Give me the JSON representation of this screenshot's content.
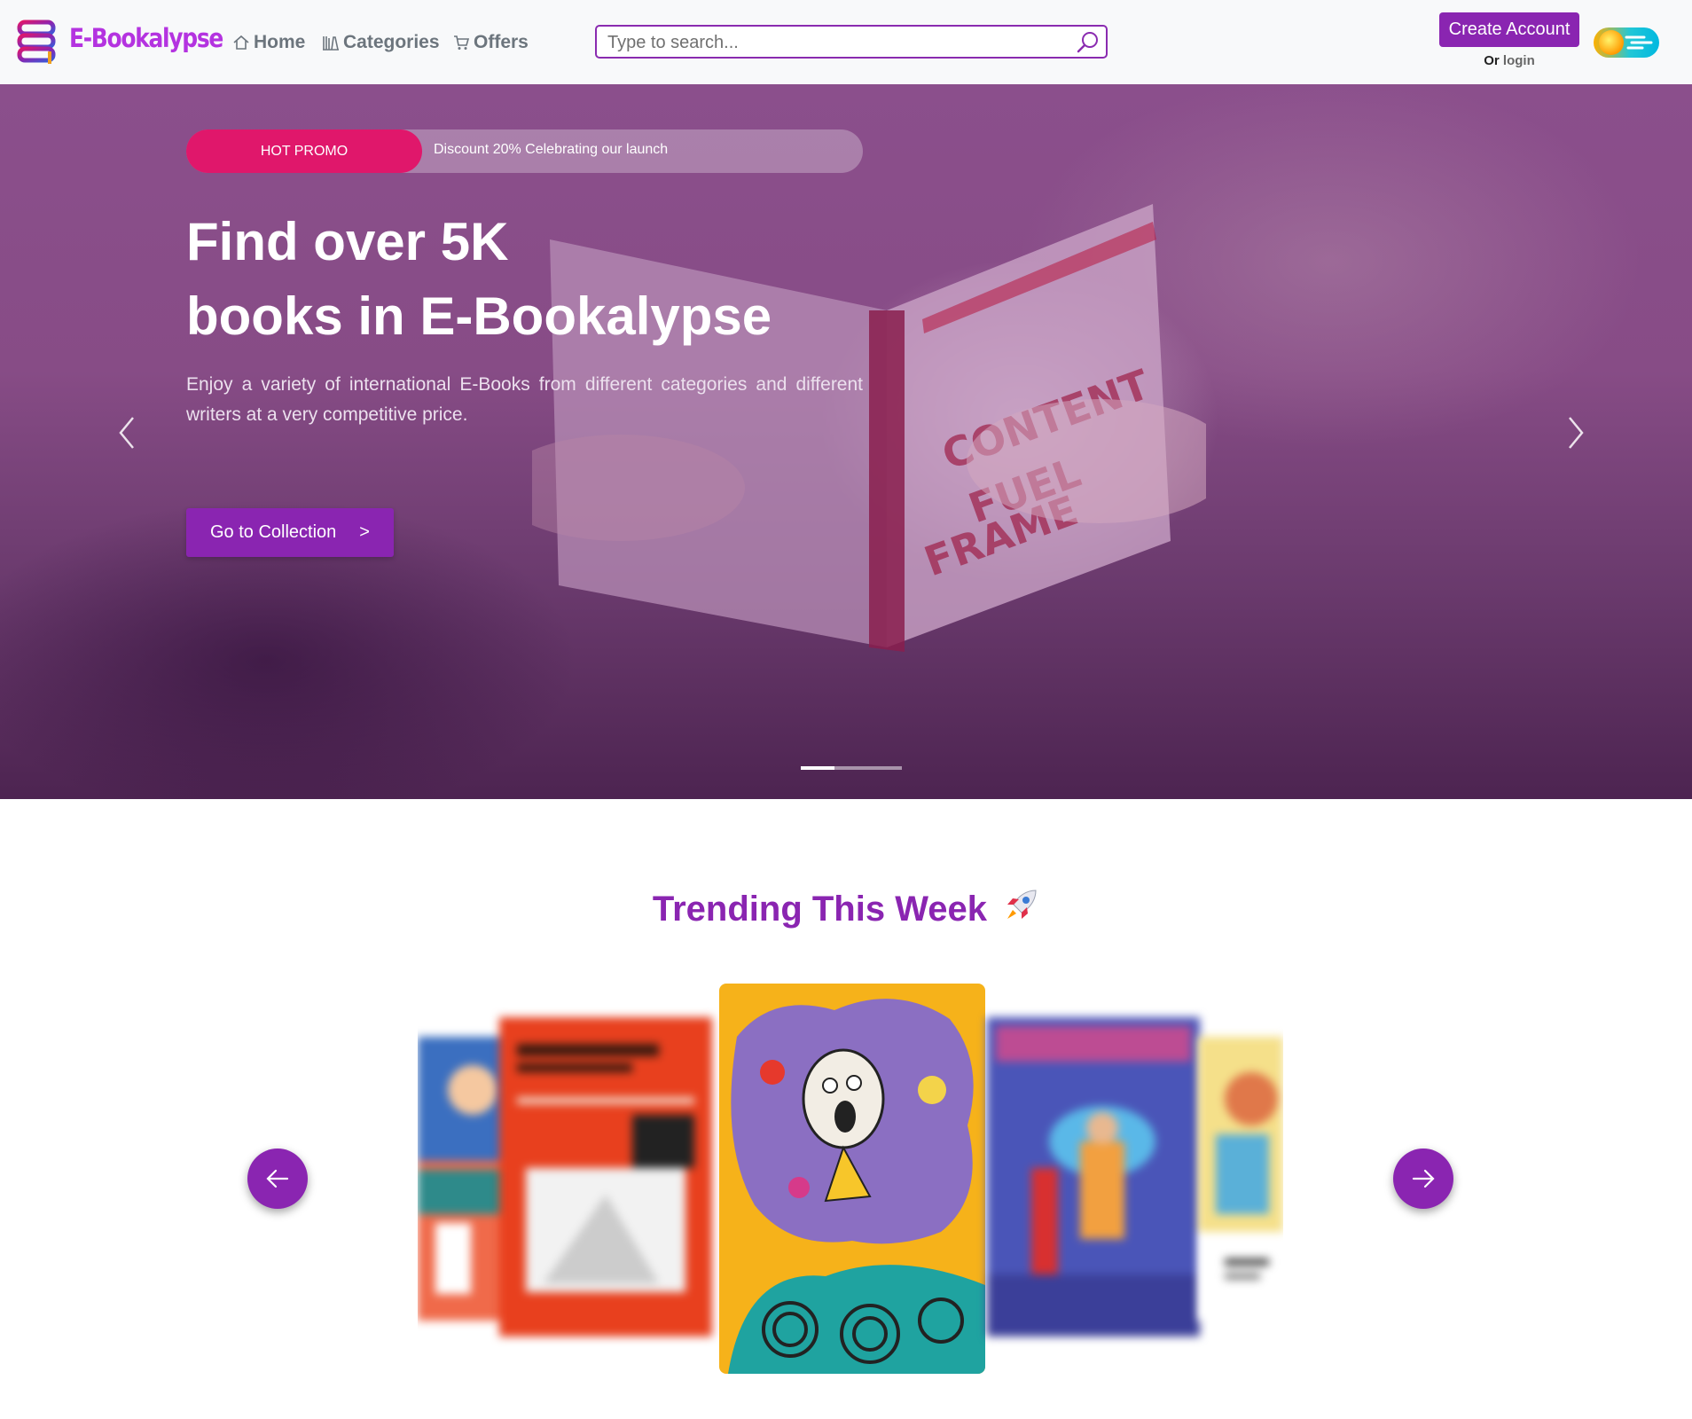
{
  "brand": {
    "name": "E-Bookalypse",
    "logo_icon": "stacked-books-logo",
    "accent_color": "#8a25b1",
    "brand_color": "#b433e0"
  },
  "nav": {
    "items": [
      {
        "label": "Home",
        "icon": "home-icon"
      },
      {
        "label": "Categories",
        "icon": "books-icon"
      },
      {
        "label": "Offers",
        "icon": "cart-icon"
      }
    ]
  },
  "search": {
    "placeholder": "Type to search...",
    "value": ""
  },
  "account": {
    "create_label": "Create Account",
    "or_label": "Or",
    "login_label": "login",
    "theme_toggle_icon": "theme-toggle-icon"
  },
  "hero": {
    "promo_badge": "HOT PROMO",
    "promo_text": "Discount 20% Celebrating our launch",
    "title_line1": "Find over 5K",
    "title_line2": "books in E-Bookalypse",
    "description": "Enjoy a variety of international E-Books from different categories and different writers at a very competitive price.",
    "cta_label": "Go to Collection",
    "cta_arrow": ">",
    "slides_count": 3,
    "active_slide": 1,
    "promo_color": "#e0176b"
  },
  "trending": {
    "title": "Trending This Week",
    "title_icon": "rocket-icon",
    "books": [
      {
        "state": "blurred",
        "icon": "book-cover-icon"
      },
      {
        "state": "blurred",
        "icon": "book-cover-icon"
      },
      {
        "state": "active",
        "icon": "book-cover-icon"
      },
      {
        "state": "blurred",
        "icon": "book-cover-icon"
      },
      {
        "state": "blurred",
        "icon": "book-cover-icon"
      }
    ],
    "prev_icon": "arrow-left-icon",
    "next_icon": "arrow-right-icon"
  }
}
